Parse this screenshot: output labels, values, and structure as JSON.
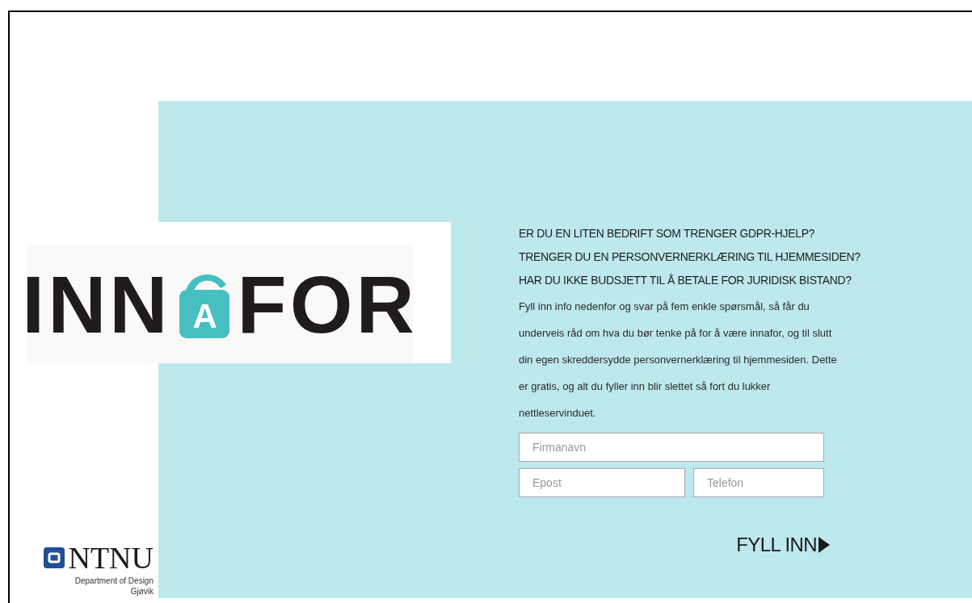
{
  "logo": {
    "left": "INN",
    "lock_letter": "A",
    "right": "FOR"
  },
  "headings": [
    "ER DU EN LITEN BEDRIFT SOM TRENGER GDPR-HJELP?",
    "TRENGER DU EN PERSONVERNERKLÆRING TIL HJEMMESIDEN?",
    "HAR DU IKKE BUDSJETT TIL Å BETALE FOR JURIDISK BISTAND?"
  ],
  "intro": "Fyll inn info nedenfor og svar på fem enkle spørsmål, så får du underveis råd om hva du bør tenke på for å være innafor, og til slutt din egen skreddersydde personvernerklæring til hjemmesiden. Dette er gratis, og alt du fyller inn blir slettet så fort du lukker nettleservinduet.",
  "form": {
    "company": {
      "placeholder": "Firmanavn"
    },
    "email": {
      "placeholder": "Epost"
    },
    "phone": {
      "placeholder": "Telefon"
    },
    "submit": "FYLL INN"
  },
  "footer": {
    "name": "NTNU",
    "department": "Department of Design",
    "location": "Gjøvik"
  }
}
